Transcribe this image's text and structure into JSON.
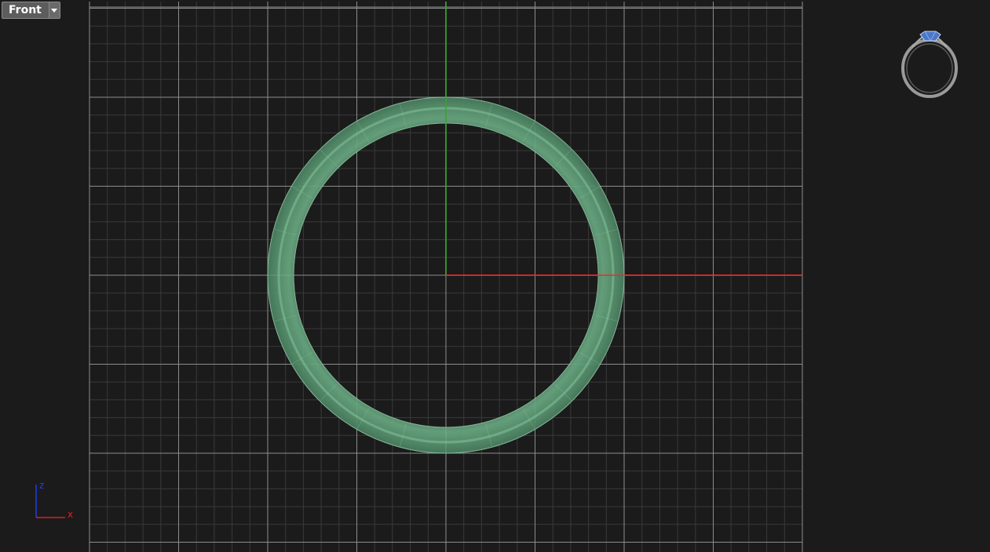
{
  "viewport": {
    "view_name": "Front",
    "view_menu_icon": "chevron-down-icon"
  },
  "axes_widget": {
    "z_label": "z",
    "x_label": "x",
    "z_color": "#2040e0",
    "x_color": "#e02020"
  },
  "scene": {
    "background": "#1b1b1b",
    "grid_minor_color": "#3a3a3a",
    "grid_major_color": "#8c8c8c",
    "x_axis_color": "#e03030",
    "z_axis_color": "#3aa030",
    "ring_color": "#5f9a75",
    "ring_edge_color": "#8cc4a0"
  },
  "preview": {
    "object": "ring-preview-icon",
    "gem_color": "#4a78c8",
    "band_color": "#9a9a9a"
  }
}
